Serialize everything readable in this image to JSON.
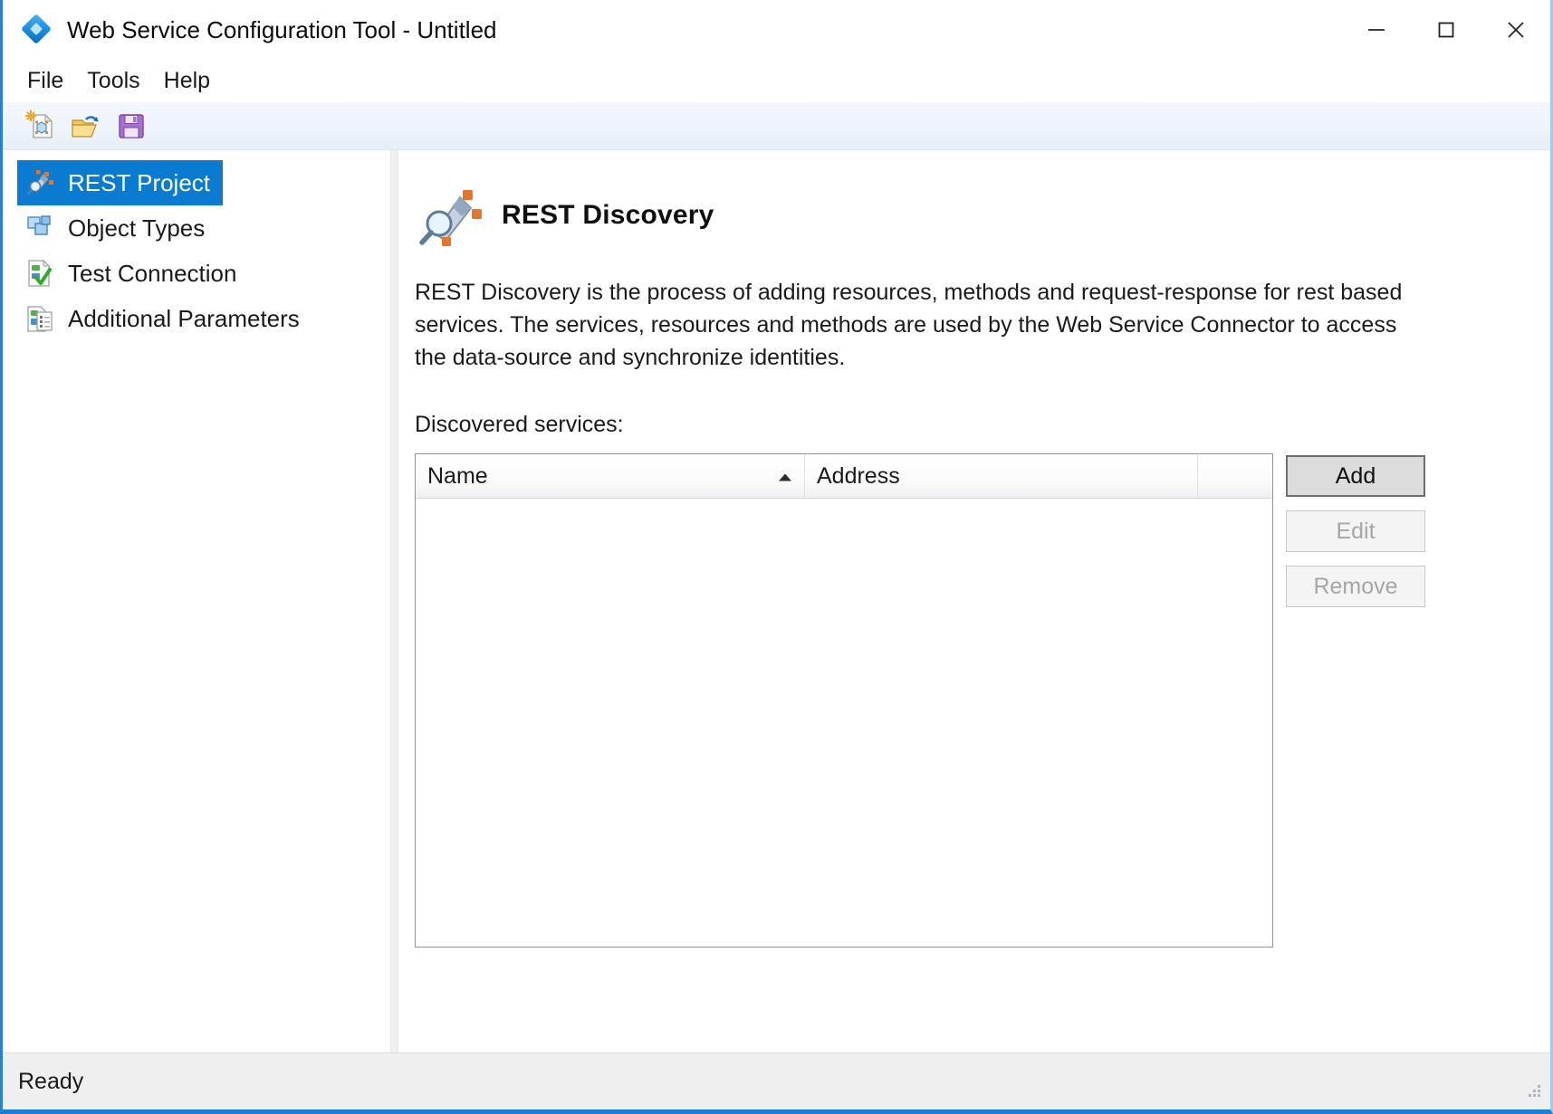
{
  "window": {
    "title": "Web Service Configuration Tool - Untitled",
    "app_icon": "diamond-logo-icon",
    "controls": {
      "minimize": "minimize-icon",
      "maximize": "maximize-icon",
      "close": "close-icon"
    },
    "accent_color": "#1a7fd8"
  },
  "menu": {
    "items": [
      {
        "label": "File"
      },
      {
        "label": "Tools"
      },
      {
        "label": "Help"
      }
    ]
  },
  "toolbar": {
    "buttons": [
      {
        "name": "new-project-icon",
        "tooltip": "New"
      },
      {
        "name": "open-project-icon",
        "tooltip": "Open"
      },
      {
        "name": "save-project-icon",
        "tooltip": "Save"
      }
    ]
  },
  "sidebar": {
    "selected_index": 0,
    "selection_color": "#0b7ad1",
    "items": [
      {
        "label": "REST Project",
        "icon": "rest-project-icon"
      },
      {
        "label": "Object Types",
        "icon": "object-types-icon"
      },
      {
        "label": "Test Connection",
        "icon": "test-connection-icon"
      },
      {
        "label": "Additional Parameters",
        "icon": "additional-parameters-icon"
      }
    ]
  },
  "main": {
    "heading": "REST Discovery",
    "heading_icon": "rest-discovery-icon",
    "description": "REST Discovery is the process of adding resources, methods and request-response for rest based services. The services, resources and methods are used by the Web Service Connector to access the data-source and synchronize identities.",
    "list_label": "Discovered services:",
    "table": {
      "columns": [
        {
          "label": "Name",
          "sort": "ascending"
        },
        {
          "label": "Address",
          "sort": "none"
        },
        {
          "label": "",
          "sort": "none"
        }
      ],
      "rows": []
    },
    "buttons": [
      {
        "label": "Add",
        "state": "enabled"
      },
      {
        "label": "Edit",
        "state": "disabled"
      },
      {
        "label": "Remove",
        "state": "disabled"
      }
    ]
  },
  "statusbar": {
    "message": "Ready",
    "grip": "resize-grip-icon"
  }
}
